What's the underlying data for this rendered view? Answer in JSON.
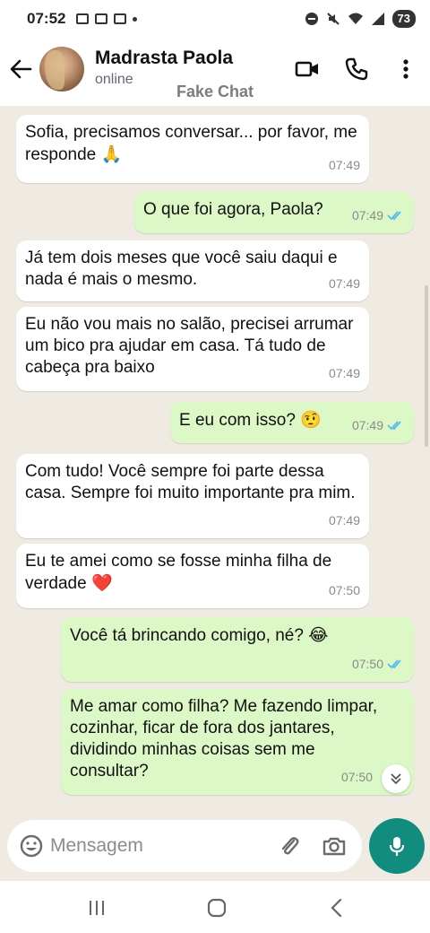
{
  "status_bar": {
    "time": "07:52",
    "battery": "73"
  },
  "header": {
    "contact_name": "Madrasta Paola",
    "contact_status": "online"
  },
  "watermark": "Fake Chat",
  "messages": [
    {
      "direction": "in",
      "text": "Sofia, precisamos conversar... por favor, me responde",
      "emoji": "🙏",
      "time": "07:49"
    },
    {
      "direction": "out",
      "text": "O que foi agora, Paola?",
      "emoji": "",
      "time": "07:49"
    },
    {
      "direction": "in",
      "text": "Já tem dois meses que você saiu daqui e nada é mais o mesmo.",
      "emoji": "",
      "time": "07:49"
    },
    {
      "direction": "in",
      "text": "Eu não vou mais no salão, precisei arrumar um bico pra ajudar em casa. Tá tudo de cabeça pra baixo",
      "emoji": "",
      "time": "07:49"
    },
    {
      "direction": "out",
      "text": "E eu com isso?",
      "emoji": "🤨",
      "time": "07:49"
    },
    {
      "direction": "in",
      "text": "Com tudo! Você sempre foi parte dessa casa. Sempre foi muito importante pra mim.",
      "emoji": "",
      "time": "07:49"
    },
    {
      "direction": "in",
      "text": "Eu te amei como se fosse minha filha de verdade",
      "emoji": "❤️",
      "time": "07:50"
    },
    {
      "direction": "out",
      "text": "Você tá brincando comigo, né?",
      "emoji": "😂",
      "time": "07:50"
    },
    {
      "direction": "out",
      "text": "Me amar como filha? Me fazendo limpar, cozinhar, ficar de fora dos jantares, dividindo minhas coisas sem me consultar?",
      "emoji": "",
      "time": "07:50"
    }
  ],
  "input": {
    "placeholder": "Mensagem"
  },
  "colors": {
    "incoming": "#ffffff",
    "outgoing": "#dcf8c6",
    "accent": "#128c7e",
    "read_ticks": "#53bdeb"
  },
  "icons": [
    "back-arrow-icon",
    "video-call-icon",
    "phone-icon",
    "more-vert-icon",
    "emoji-icon",
    "attach-icon",
    "camera-icon",
    "mic-icon",
    "scroll-down-icon"
  ]
}
